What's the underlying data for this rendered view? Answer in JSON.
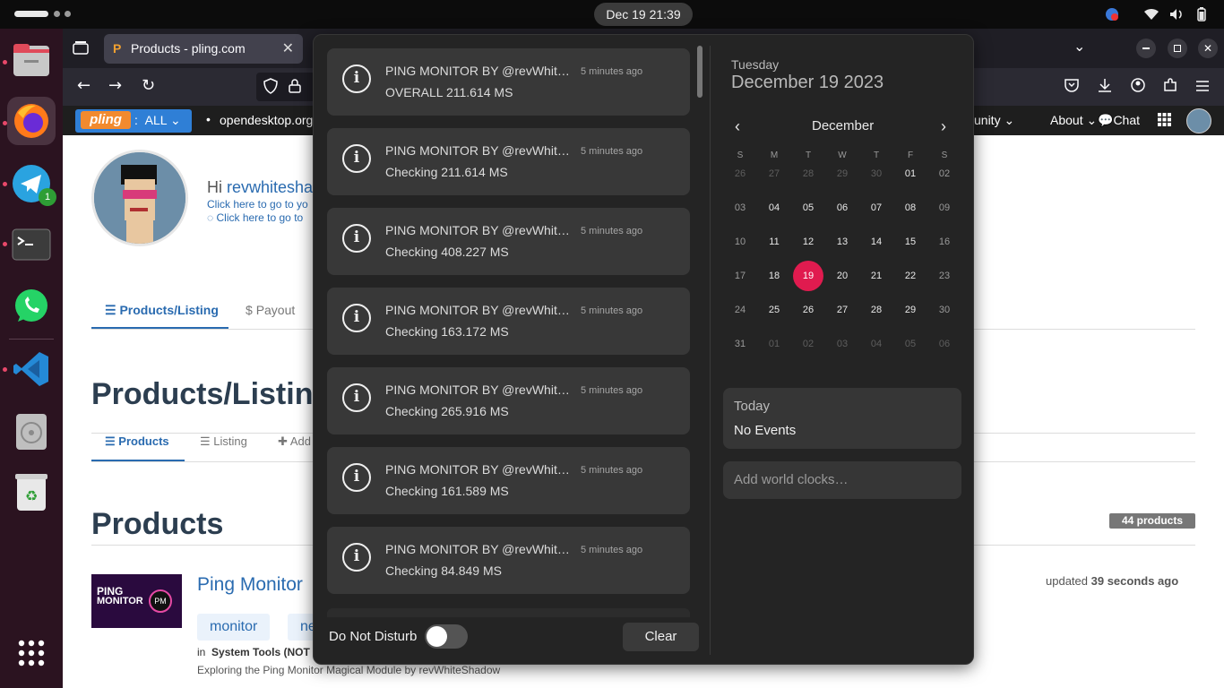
{
  "topbar": {
    "clock": "Dec 19  21:39"
  },
  "dock": {
    "telegram_badge": "1"
  },
  "browser": {
    "tab_title": "Products - pling.com",
    "tab_close": "✕",
    "bookmarks": {
      "pling_all": "ALL",
      "opendesktop": "opendesktop.org",
      "community": "unity",
      "about": "About",
      "chat": "Chat"
    }
  },
  "page": {
    "greeting_prefix": "Hi ",
    "greeting_user": "revwhitesha",
    "link1": "Click here to go to yo",
    "link2": "Click here to go to",
    "tab_products_listing": "Products/Listing",
    "tab_payout": "Payout",
    "heading_listing": "Products/Listing",
    "subtab_products": "Products",
    "subtab_listing": "Listing",
    "subtab_add": "Add",
    "heading_products": "Products",
    "count_badge": "44 products",
    "product_title": "Ping Monitor",
    "updated_label": "updated",
    "updated_value": "39 seconds ago",
    "tags": [
      "monitor",
      "ne"
    ],
    "in_label": "in",
    "category": "System Tools (NOT",
    "description": "Exploring the Ping Monitor Magical Module by revWhiteShadow",
    "thumb_text1": "PING",
    "thumb_text2": "MONITOR",
    "thumb_badge": "PM"
  },
  "notifications": [
    {
      "title": "PING MONITOR BY @revWhiteShadow",
      "time": "5 minutes ago",
      "body": "OVERALL 211.614 MS"
    },
    {
      "title": "PING MONITOR BY @revWhiteShadow",
      "time": "5 minutes ago",
      "body": "Checking 211.614 MS"
    },
    {
      "title": "PING MONITOR BY @revWhiteShadow",
      "time": "5 minutes ago",
      "body": "Checking 408.227 MS"
    },
    {
      "title": "PING MONITOR BY @revWhiteShadow",
      "time": "5 minutes ago",
      "body": "Checking 163.172 MS"
    },
    {
      "title": "PING MONITOR BY @revWhiteShadow",
      "time": "5 minutes ago",
      "body": "Checking 265.916 MS"
    },
    {
      "title": "PING MONITOR BY @revWhiteShadow",
      "time": "5 minutes ago",
      "body": "Checking 161.589 MS"
    },
    {
      "title": "PING MONITOR BY @revWhiteShadow",
      "time": "5 minutes ago",
      "body": "Checking 84.849 MS"
    }
  ],
  "footer": {
    "dnd_label": "Do Not Disturb",
    "dnd_on": false,
    "clear_label": "Clear"
  },
  "calendar": {
    "weekday": "Tuesday",
    "date": "December 19 2023",
    "month": "December",
    "prev": "‹",
    "next": "›",
    "day_headers": [
      "S",
      "M",
      "T",
      "W",
      "T",
      "F",
      "S"
    ],
    "weeks": [
      [
        "26",
        "27",
        "28",
        "29",
        "30",
        "01",
        "02"
      ],
      [
        "03",
        "04",
        "05",
        "06",
        "07",
        "08",
        "09"
      ],
      [
        "10",
        "11",
        "12",
        "13",
        "14",
        "15",
        "16"
      ],
      [
        "17",
        "18",
        "19",
        "20",
        "21",
        "22",
        "23"
      ],
      [
        "24",
        "25",
        "26",
        "27",
        "28",
        "29",
        "30"
      ],
      [
        "31",
        "01",
        "02",
        "03",
        "04",
        "05",
        "06"
      ]
    ],
    "today": "19",
    "events_title": "Today",
    "events_body": "No Events",
    "world_clocks": "Add world clocks…",
    "today_color": "#e01b4f"
  }
}
